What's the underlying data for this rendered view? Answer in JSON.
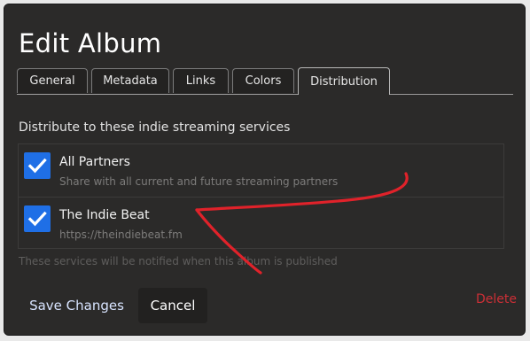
{
  "dialog": {
    "title": "Edit Album"
  },
  "tabs": [
    {
      "label": "General",
      "active": false
    },
    {
      "label": "Metadata",
      "active": false
    },
    {
      "label": "Links",
      "active": false
    },
    {
      "label": "Colors",
      "active": false
    },
    {
      "label": "Distribution",
      "active": true
    }
  ],
  "distribution": {
    "heading": "Distribute to these indie streaming services",
    "services": [
      {
        "name": "All Partners",
        "description": "Share with all current and future streaming partners",
        "checked": true
      },
      {
        "name": "The Indie Beat",
        "description": "https://theindiebeat.fm",
        "checked": true
      }
    ],
    "footnote": "These services will be notified when this album is published"
  },
  "actions": {
    "save_label": "Save Changes",
    "cancel_label": "Cancel",
    "delete_label": "Delete"
  },
  "colors": {
    "background": "#2b2a29",
    "checkbox": "#1f6fe6",
    "delete": "#cc2f36",
    "annotation_arrow": "#e0222a"
  },
  "icons": {
    "checkbox_mark": "checkmark-icon",
    "annotation": "red-arrow-annotation"
  }
}
